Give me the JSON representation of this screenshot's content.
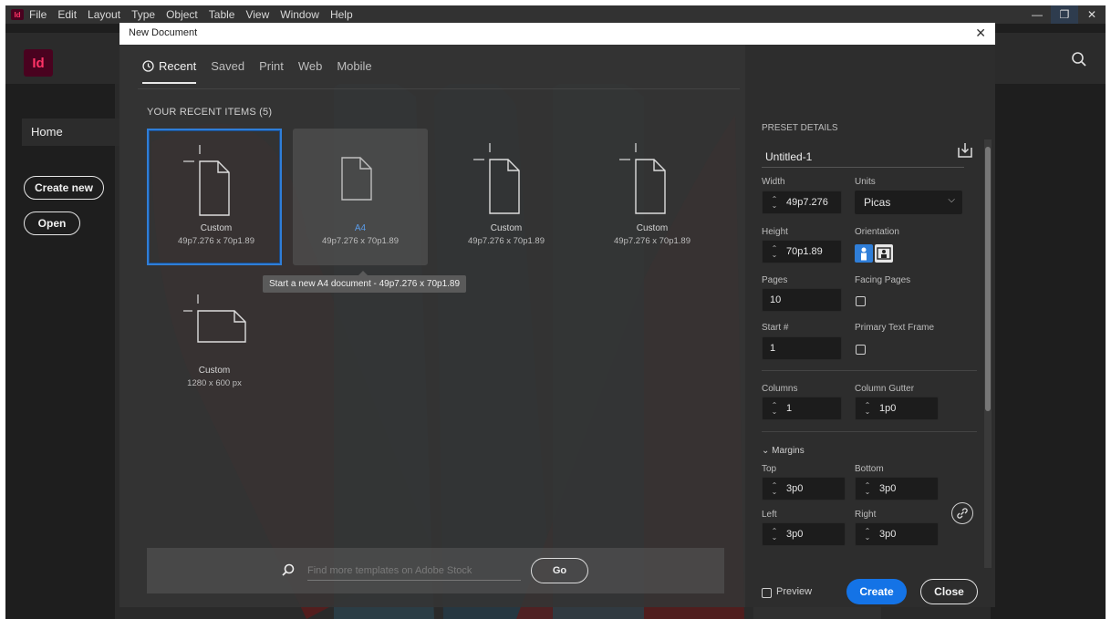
{
  "menubar": {
    "app_badge": "Id",
    "items": [
      "File",
      "Edit",
      "Layout",
      "Type",
      "Object",
      "Table",
      "View",
      "Window",
      "Help"
    ],
    "window_controls": [
      "minimize-icon",
      "restore-icon",
      "close-icon"
    ]
  },
  "app_header": {
    "logo": "Id",
    "search_icon": "search-icon"
  },
  "home_panel": {
    "home_label": "Home",
    "create_new_label": "Create new",
    "open_label": "Open"
  },
  "dialog": {
    "title": "New Document",
    "close_glyph": "✕",
    "tabs": [
      {
        "label": "Recent",
        "active": true,
        "icon": "clock-icon"
      },
      {
        "label": "Saved",
        "active": false
      },
      {
        "label": "Print",
        "active": false
      },
      {
        "label": "Web",
        "active": false
      },
      {
        "label": "Mobile",
        "active": false
      }
    ],
    "recent_title": "YOUR RECENT ITEMS  (5)",
    "recent_items": [
      {
        "name": "Custom",
        "size": "49p7.276 x 70p1.89",
        "selected": true
      },
      {
        "name": "A4",
        "size": "49p7.276 x 70p1.89",
        "hover": true
      },
      {
        "name": "Custom",
        "size": "49p7.276 x 70p1.89"
      },
      {
        "name": "Custom",
        "size": "49p7.276 x 70p1.89"
      },
      {
        "name": "Custom",
        "size": "1280 x 600 px"
      }
    ],
    "tooltip": "Start a new A4 document - 49p7.276 x 70p1.89",
    "stock_search": {
      "placeholder": "Find more templates on Adobe Stock",
      "go_label": "Go"
    }
  },
  "preset": {
    "section_title": "PRESET DETAILS",
    "name": "Untitled-1",
    "width_label": "Width",
    "width_value": "49p7.276",
    "units_label": "Units",
    "units_value": "Picas",
    "height_label": "Height",
    "height_value": "70p1.89",
    "orientation_label": "Orientation",
    "pages_label": "Pages",
    "pages_value": "10",
    "facing_pages_label": "Facing Pages",
    "start_label": "Start #",
    "start_value": "1",
    "primary_text_frame_label": "Primary Text Frame",
    "columns_label": "Columns",
    "columns_value": "1",
    "gutter_label": "Column Gutter",
    "gutter_value": "1p0",
    "margins_label": "Margins",
    "top_label": "Top",
    "top_value": "3p0",
    "bottom_label": "Bottom",
    "bottom_value": "3p0",
    "left_label": "Left",
    "left_value": "3p0",
    "right_label": "Right",
    "right_value": "3p0",
    "preview_label": "Preview",
    "create_label": "Create",
    "close_label": "Close"
  },
  "colors": {
    "accent_blue": "#1473e6",
    "selection_blue": "#2f7ed8",
    "indesign_pink": "#ff3366",
    "art_red": "#6a1a1a",
    "art_teal": "#233a44"
  }
}
